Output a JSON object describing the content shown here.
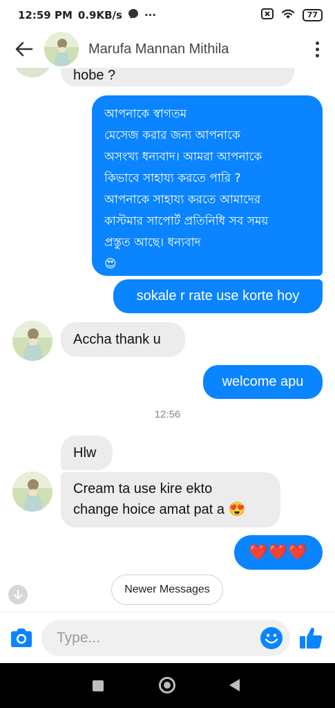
{
  "status": {
    "time": "12:59 PM",
    "speed": "0.9KB/s",
    "more": "···",
    "battery": "77"
  },
  "header": {
    "contact_name": "Marufa Mannan Mithila"
  },
  "messages": {
    "cut_off_top": "hobe ?",
    "welcome": "আপনাকে স্বাগতম\nমেসেজ করার জন্য আপনাকে\nঅসংখ্য ধন্যবাদ। আমরা আপনাকে\nকিভাবে সাহায্য করতে পারি ?\nআপনাকে সাহায্য করতে আমাদের\nকাস্টমার সাপোর্ট প্রতিনিধি সব সময়\nপ্রস্তুত আছে। ধন্যবাদ\n😍",
    "out_1": "sokale r rate use korte hoy",
    "in_1": "Accha thank u",
    "out_2": "welcome apu",
    "timestamp": "12:56",
    "in_2": "Hlw",
    "in_3_line1": "Cream ta use kire ekto",
    "in_3_line2": "change hoice amat pat a 😍",
    "out_3": "❤️❤️❤️"
  },
  "newer_messages_label": "Newer Messages",
  "composer": {
    "placeholder": "Type..."
  },
  "colors": {
    "outgoing": "#0a84ff",
    "incoming": "#ececec"
  },
  "icons": [
    "back-arrow-icon",
    "more-vertical-icon",
    "camera-icon",
    "emoji-icon",
    "thumbs-up-icon",
    "arrow-down-icon"
  ]
}
